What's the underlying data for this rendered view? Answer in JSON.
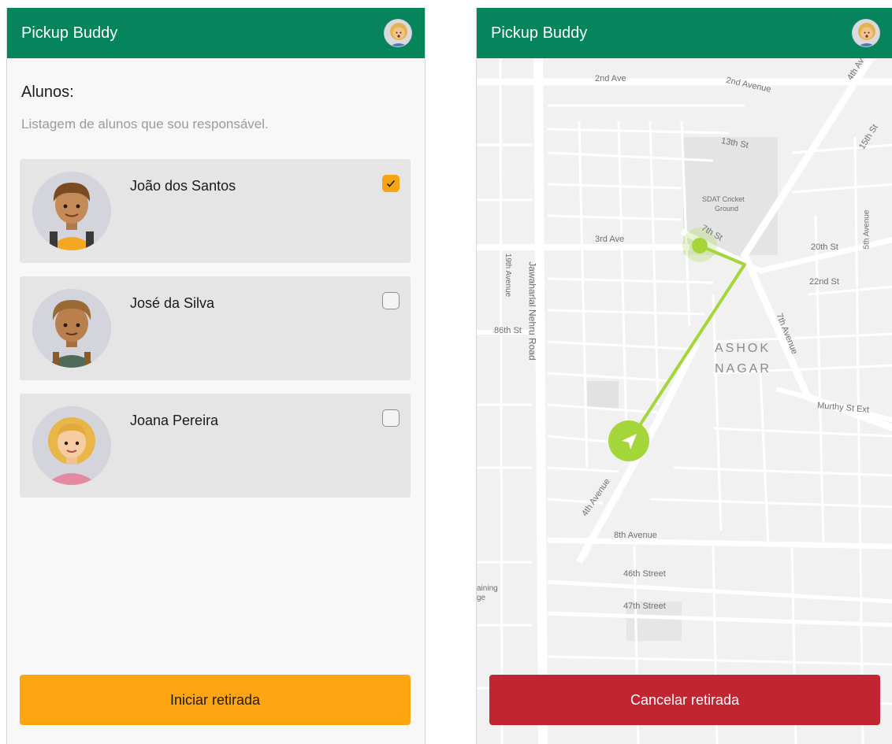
{
  "app": {
    "title": "Pickup Buddy"
  },
  "list_screen": {
    "heading": "Alunos:",
    "subheading": "Listagem de alunos que sou responsável.",
    "students": [
      {
        "name": "João dos Santos",
        "checked": true
      },
      {
        "name": "José da Silva",
        "checked": false
      },
      {
        "name": "Joana Pereira",
        "checked": false
      }
    ],
    "start_button": "Iniciar retirada"
  },
  "map_screen": {
    "labels": {
      "ave2": "2nd Ave",
      "avenue2": "2nd Avenue",
      "ave4_top": "4th Av",
      "st13": "13th St",
      "st15": "15th St",
      "cricket": "SDAT Cricket",
      "ground": "Ground",
      "st7": "7th St",
      "ave3": "3rd Ave",
      "ave19": "19th Avenue",
      "nehru": "Jawaharlal Nehru Road",
      "st20": "20th St",
      "ave5": "5th Avenue",
      "st22": "22nd St",
      "ave7": "7th Avenue",
      "st86": "86th St",
      "ashok": "ASHOK",
      "nagar": "NAGAR",
      "murthy": "Murthy St Ext",
      "ave4": "4th Avenue",
      "ave8": "8th Avenue",
      "st46": "46th Street",
      "st47": "47th Street",
      "training": "aining",
      "ge": "ge"
    },
    "cancel_button": "Cancelar retirada"
  },
  "colors": {
    "appbar": "#06845b",
    "accent_orange": "#fea611",
    "cancel_red": "#c22532",
    "route_green": "#a4d63a"
  }
}
